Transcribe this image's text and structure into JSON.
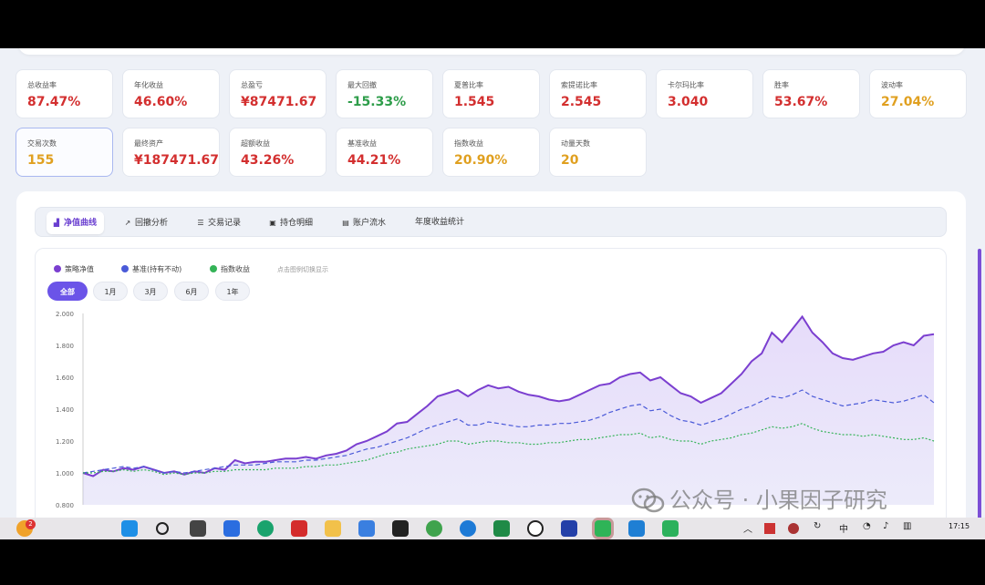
{
  "metrics_row1": [
    {
      "label": "总收益率",
      "value": "87.47%",
      "color": "red"
    },
    {
      "label": "年化收益",
      "value": "46.60%",
      "color": "red"
    },
    {
      "label": "总盈亏",
      "value": "¥87471.67",
      "color": "red"
    },
    {
      "label": "最大回撤",
      "value": "-15.33%",
      "color": "green"
    },
    {
      "label": "夏普比率",
      "value": "1.545",
      "color": "red"
    },
    {
      "label": "索提诺比率",
      "value": "2.545",
      "color": "red"
    },
    {
      "label": "卡尔玛比率",
      "value": "3.040",
      "color": "red"
    },
    {
      "label": "胜率",
      "value": "53.67%",
      "color": "red"
    },
    {
      "label": "波动率",
      "value": "27.04%",
      "color": "orange"
    }
  ],
  "metrics_row2": [
    {
      "label": "交易次数",
      "value": "155",
      "color": "orange"
    },
    {
      "label": "最终资产",
      "value": "¥187471.67",
      "color": "red"
    },
    {
      "label": "超额收益",
      "value": "43.26%",
      "color": "red"
    },
    {
      "label": "基准收益",
      "value": "44.21%",
      "color": "red"
    },
    {
      "label": "指数收益",
      "value": "20.90%",
      "color": "orange"
    },
    {
      "label": "动量天数",
      "value": "20",
      "color": "orange"
    }
  ],
  "tabs": [
    {
      "label": "净值曲线",
      "icon": "chart-area-icon",
      "glyph": "▟"
    },
    {
      "label": "回撤分析",
      "icon": "line-chart-icon",
      "glyph": "↗"
    },
    {
      "label": "交易记录",
      "icon": "list-icon",
      "glyph": "☰"
    },
    {
      "label": "持仓明细",
      "icon": "briefcase-icon",
      "glyph": "▣"
    },
    {
      "label": "账户流水",
      "icon": "ledger-icon",
      "glyph": "▤"
    },
    {
      "label": "年度收益统计",
      "icon": "",
      "glyph": ""
    }
  ],
  "legend": [
    {
      "label": "策略净值",
      "color": "#7b3fd0"
    },
    {
      "label": "基准(持有不动)",
      "color": "#4a5ad8"
    },
    {
      "label": "指数收益",
      "color": "#34b357"
    }
  ],
  "legend_hint": "点击图例切换显示",
  "ranges": [
    "全部",
    "1月",
    "3月",
    "6月",
    "1年"
  ],
  "chart_data": {
    "type": "line",
    "ylim": [
      0.8,
      2.0
    ],
    "yticks": [
      "0.800",
      "1.000",
      "1.200",
      "1.400",
      "1.600",
      "1.800",
      "2.000"
    ],
    "series": [
      {
        "name": "策略净值",
        "color": "#7b3fd0",
        "style": "solid",
        "values": [
          1.0,
          0.98,
          1.02,
          1.01,
          1.03,
          1.02,
          1.04,
          1.02,
          1.0,
          1.01,
          0.99,
          1.01,
          1.0,
          1.03,
          1.02,
          1.08,
          1.06,
          1.07,
          1.07,
          1.08,
          1.09,
          1.09,
          1.1,
          1.09,
          1.11,
          1.12,
          1.14,
          1.18,
          1.2,
          1.23,
          1.26,
          1.31,
          1.32,
          1.37,
          1.42,
          1.48,
          1.5,
          1.52,
          1.48,
          1.52,
          1.55,
          1.53,
          1.54,
          1.51,
          1.49,
          1.48,
          1.46,
          1.45,
          1.46,
          1.49,
          1.52,
          1.55,
          1.56,
          1.6,
          1.62,
          1.63,
          1.58,
          1.6,
          1.55,
          1.5,
          1.48,
          1.44,
          1.47,
          1.5,
          1.56,
          1.62,
          1.7,
          1.75,
          1.88,
          1.82,
          1.9,
          1.98,
          1.88,
          1.82,
          1.75,
          1.72,
          1.71,
          1.73,
          1.75,
          1.76,
          1.8,
          1.82,
          1.8,
          1.86,
          1.87
        ]
      },
      {
        "name": "基准(持有不动)",
        "color": "#4a5ad8",
        "style": "dashed",
        "values": [
          1.0,
          1.01,
          1.02,
          1.03,
          1.04,
          1.03,
          1.04,
          1.02,
          1.0,
          1.01,
          1.0,
          1.01,
          1.02,
          1.03,
          1.04,
          1.05,
          1.05,
          1.05,
          1.06,
          1.07,
          1.07,
          1.07,
          1.08,
          1.08,
          1.09,
          1.1,
          1.11,
          1.13,
          1.15,
          1.16,
          1.18,
          1.2,
          1.22,
          1.25,
          1.28,
          1.3,
          1.32,
          1.34,
          1.3,
          1.3,
          1.32,
          1.31,
          1.3,
          1.29,
          1.29,
          1.3,
          1.3,
          1.31,
          1.31,
          1.32,
          1.33,
          1.35,
          1.38,
          1.4,
          1.42,
          1.43,
          1.39,
          1.4,
          1.36,
          1.33,
          1.32,
          1.3,
          1.32,
          1.34,
          1.37,
          1.4,
          1.42,
          1.45,
          1.48,
          1.47,
          1.49,
          1.52,
          1.48,
          1.46,
          1.44,
          1.42,
          1.43,
          1.44,
          1.46,
          1.45,
          1.44,
          1.45,
          1.47,
          1.49,
          1.44
        ]
      },
      {
        "name": "指数收益",
        "color": "#34b357",
        "style": "dotted",
        "values": [
          1.0,
          1.0,
          1.01,
          1.01,
          1.02,
          1.01,
          1.02,
          1.01,
          0.99,
          1.0,
          0.99,
          1.0,
          1.0,
          1.01,
          1.01,
          1.02,
          1.02,
          1.02,
          1.02,
          1.03,
          1.03,
          1.03,
          1.04,
          1.04,
          1.05,
          1.05,
          1.06,
          1.07,
          1.08,
          1.1,
          1.12,
          1.13,
          1.15,
          1.16,
          1.17,
          1.18,
          1.2,
          1.2,
          1.18,
          1.19,
          1.2,
          1.2,
          1.19,
          1.19,
          1.18,
          1.18,
          1.19,
          1.19,
          1.2,
          1.21,
          1.21,
          1.22,
          1.23,
          1.24,
          1.24,
          1.25,
          1.22,
          1.23,
          1.21,
          1.2,
          1.2,
          1.18,
          1.2,
          1.21,
          1.22,
          1.24,
          1.25,
          1.27,
          1.29,
          1.28,
          1.29,
          1.31,
          1.28,
          1.26,
          1.25,
          1.24,
          1.24,
          1.23,
          1.24,
          1.23,
          1.22,
          1.21,
          1.21,
          1.22,
          1.2
        ]
      }
    ]
  },
  "watermark": "公众号 · 小果因子研究",
  "taskbar": {
    "badge": "2",
    "clock": "17:15",
    "tray": [
      "︿",
      "中",
      "◔",
      "♪",
      "▥"
    ]
  }
}
